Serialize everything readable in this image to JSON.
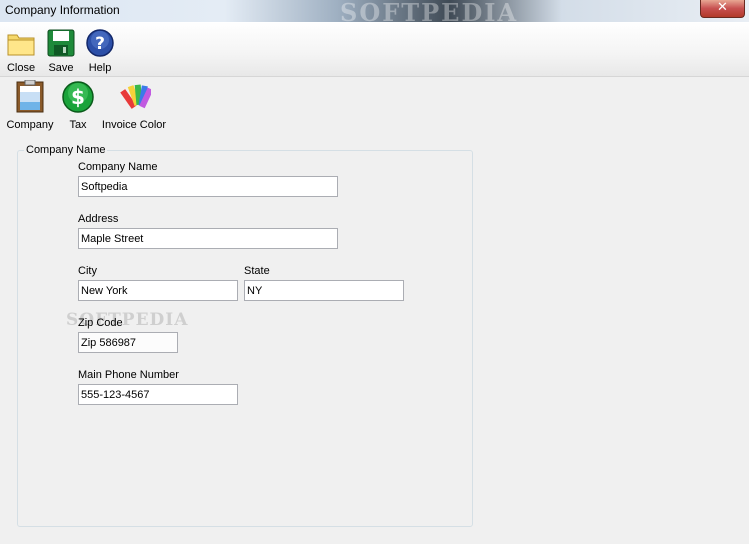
{
  "window": {
    "title": "Company Information",
    "watermark": "SOFTPEDIA",
    "close_glyph": "✕"
  },
  "toolbar": {
    "close_label": "Close",
    "save_label": "Save",
    "help_label": "Help"
  },
  "sections": {
    "company_label": "Company",
    "tax_label": "Tax",
    "invoice_color_label": "Invoice Color"
  },
  "group": {
    "title": "Company Name"
  },
  "fields": {
    "company_name": {
      "label": "Company Name",
      "value": "Softpedia"
    },
    "address": {
      "label": "Address",
      "value": "Maple Street"
    },
    "city": {
      "label": "City",
      "value": "New York"
    },
    "state": {
      "label": "State",
      "value": "NY"
    },
    "zip": {
      "label": "Zip Code",
      "value": "Zip 586987"
    },
    "phone": {
      "label": "Main Phone Number",
      "value": "555-123-4567"
    }
  },
  "zip_watermark": "SOFTPEDIA",
  "colors": {
    "folder": "#f5d86b",
    "save": "#1e8a3a",
    "help": "#2c4fa8",
    "tax": "#1aa33a"
  },
  "icons": [
    "folder-icon",
    "floppy-disk-icon",
    "question-icon",
    "clipboard-icon",
    "dollar-icon",
    "color-palette-icon"
  ]
}
